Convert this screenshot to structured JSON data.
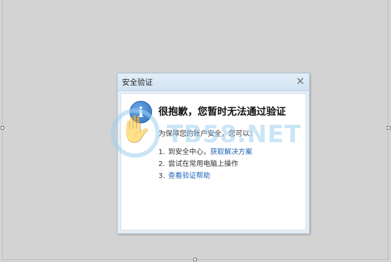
{
  "dialog": {
    "title": "安全验证",
    "close_label": "✕",
    "icon": "info-icon",
    "icon_glyph": "i",
    "heading": "很抱歉，您暂时无法通过验证",
    "description": "为保障您的账户安全，您可以：",
    "steps": [
      {
        "num": "1.",
        "text": "到安全中心，",
        "link": "获取解决方案"
      },
      {
        "num": "2.",
        "text": "尝试在常用电脑上操作",
        "link": ""
      },
      {
        "num": "3.",
        "text": "",
        "link": "查看验证帮助"
      }
    ]
  },
  "watermark": {
    "text": "TB58.NET",
    "icon": "hand-icon"
  },
  "colors": {
    "link": "#1d63b5",
    "titlebar": "#d2e3f3",
    "icon": "#2d6fbe",
    "background": "#d3d3d3"
  }
}
